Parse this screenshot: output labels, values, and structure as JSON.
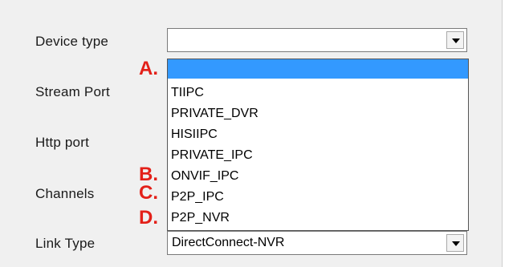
{
  "form": {
    "device_type_label": "Device type",
    "stream_port_label": "Stream Port",
    "http_port_label": "Http port",
    "channels_label": "Channels",
    "link_type_label": "Link Type"
  },
  "device_type_combo": {
    "value": ""
  },
  "device_type_options": [
    "",
    "TIIPC",
    "PRIVATE_DVR",
    "HISIIPC",
    "PRIVATE_IPC",
    "ONVIF_IPC",
    "P2P_IPC",
    "P2P_NVR"
  ],
  "link_type_combo": {
    "value": "DirectConnect-NVR"
  },
  "annotations": {
    "a": "A.",
    "b": "B.",
    "c": "C.",
    "d": "D."
  },
  "colors": {
    "highlight": "#3399ff",
    "annotation": "#e32019"
  },
  "icons": {
    "dropdown_arrow": "chevron-down-icon"
  }
}
